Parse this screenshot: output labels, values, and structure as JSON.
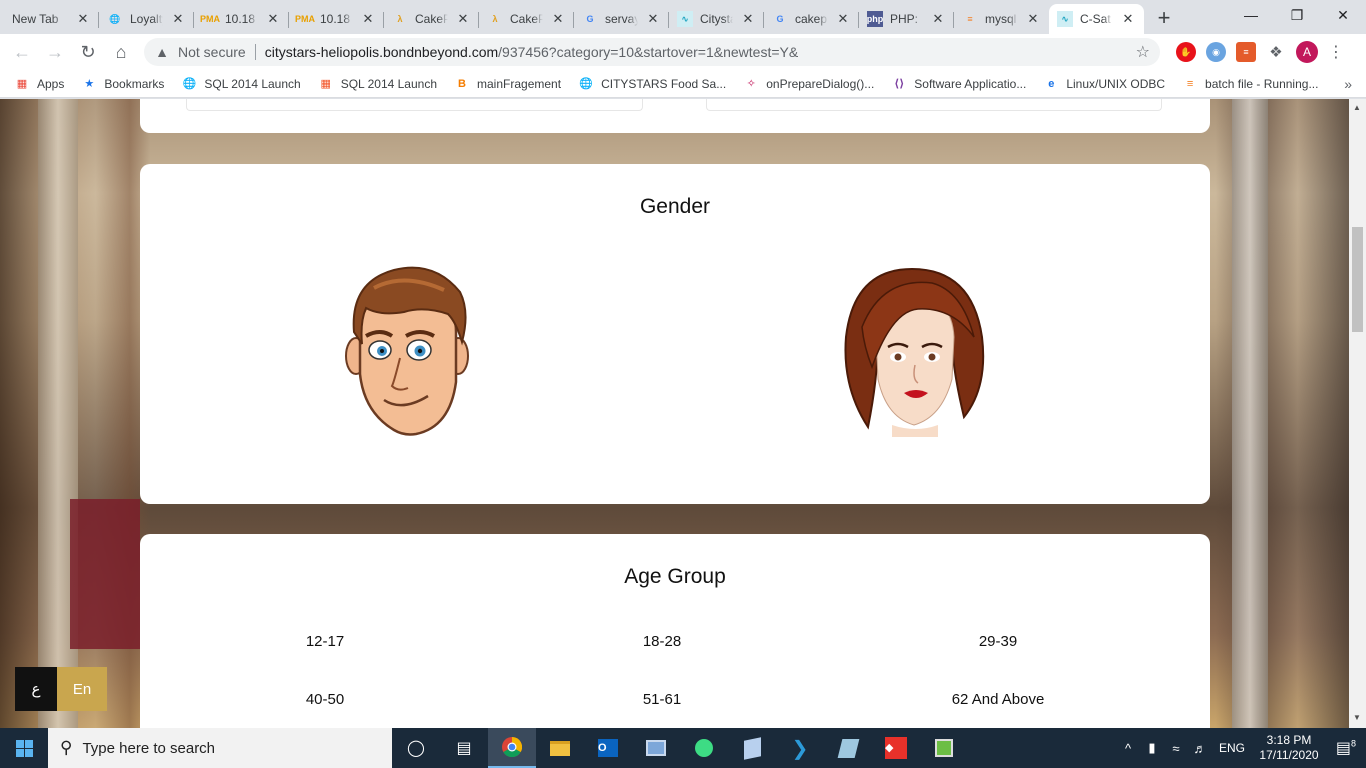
{
  "tabs": [
    {
      "title": "New Tab",
      "icon": "none",
      "active": false
    },
    {
      "title": "Loyalty",
      "icon": "globe-icon",
      "active": false
    },
    {
      "title": "10.18",
      "icon": "pma-icon",
      "active": false
    },
    {
      "title": "10.18",
      "icon": "pma-icon",
      "active": false
    },
    {
      "title": "CakePHP",
      "icon": "cake-icon",
      "active": false
    },
    {
      "title": "CakePHP",
      "icon": "cake-icon",
      "active": false
    },
    {
      "title": "servay",
      "icon": "google-icon",
      "active": false
    },
    {
      "title": "Citystars",
      "icon": "chart-icon",
      "active": false
    },
    {
      "title": "cakep",
      "icon": "google-icon",
      "active": false
    },
    {
      "title": "PHP:",
      "icon": "php-icon",
      "active": false
    },
    {
      "title": "mysql",
      "icon": "stack-icon",
      "active": false
    },
    {
      "title": "C-Sat",
      "icon": "chart-icon",
      "active": true
    }
  ],
  "address": {
    "security": "Not secure",
    "host": "citystars-heliopolis.bondnbeyond.com",
    "path": "/937456?category=10&startover=1&newtest=Y&"
  },
  "extensions": {
    "avatar_letter": "A",
    "colors": [
      "#e8121a",
      "#6aa4e0",
      "#e45b2b"
    ]
  },
  "bookmarks": [
    {
      "label": "Apps",
      "icon": "apps-grid-icon"
    },
    {
      "label": "Bookmarks",
      "icon": "star-icon"
    },
    {
      "label": "SQL 2014 Launch",
      "icon": "globe-icon"
    },
    {
      "label": "SQL 2014 Launch",
      "icon": "windows-logo-icon"
    },
    {
      "label": "mainFragement",
      "icon": "blogger-icon"
    },
    {
      "label": "CITYSTARS Food Sa...",
      "icon": "globe-icon"
    },
    {
      "label": "onPrepareDialog()...",
      "icon": "android-icon"
    },
    {
      "label": "Software Applicatio...",
      "icon": "code-icon"
    },
    {
      "label": "Linux/UNIX ODBC",
      "icon": "e-icon"
    },
    {
      "label": "batch file - Running...",
      "icon": "stack-icon"
    }
  ],
  "survey": {
    "gender": {
      "title": "Gender",
      "options": [
        "male",
        "female"
      ]
    },
    "age": {
      "title": "Age Group",
      "options": [
        "12-17",
        "18-28",
        "29-39",
        "40-50",
        "51-61",
        "62 And Above"
      ]
    }
  },
  "language": {
    "arabic": "ع",
    "english": "En"
  },
  "taskbar": {
    "search_placeholder": "Type here to search",
    "lang": "ENG",
    "time": "3:18 PM",
    "date": "17/11/2020",
    "notifications": "8"
  }
}
